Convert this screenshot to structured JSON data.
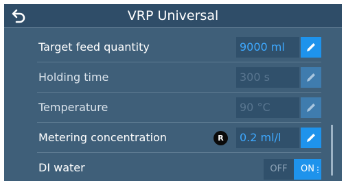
{
  "header": {
    "title": "VRP Universal",
    "back_icon": "back-arrow-icon"
  },
  "rows": [
    {
      "label": "Target feed quantity",
      "value": "9000 ml",
      "state": "enabled",
      "icon": "pencil-edit-icon"
    },
    {
      "label": "Holding time",
      "value": "300 s",
      "state": "disabled",
      "icon": "pencil-edit-icon"
    },
    {
      "label": "Temperature",
      "value": "90 °C",
      "state": "disabled",
      "icon": "pencil-edit-icon"
    },
    {
      "label": "Metering concentration",
      "badge": "R",
      "value": "0.2 ml/l",
      "state": "enabled",
      "icon": "pencil-edit-icon"
    },
    {
      "label": "DI water",
      "toggle": {
        "off_label": "OFF",
        "on_label": "ON",
        "selected": "ON"
      }
    }
  ],
  "colors": {
    "background": "#3f5f79",
    "header": "#2f4d68",
    "accent": "#1e93ec",
    "value_active": "#3ea9ff"
  }
}
